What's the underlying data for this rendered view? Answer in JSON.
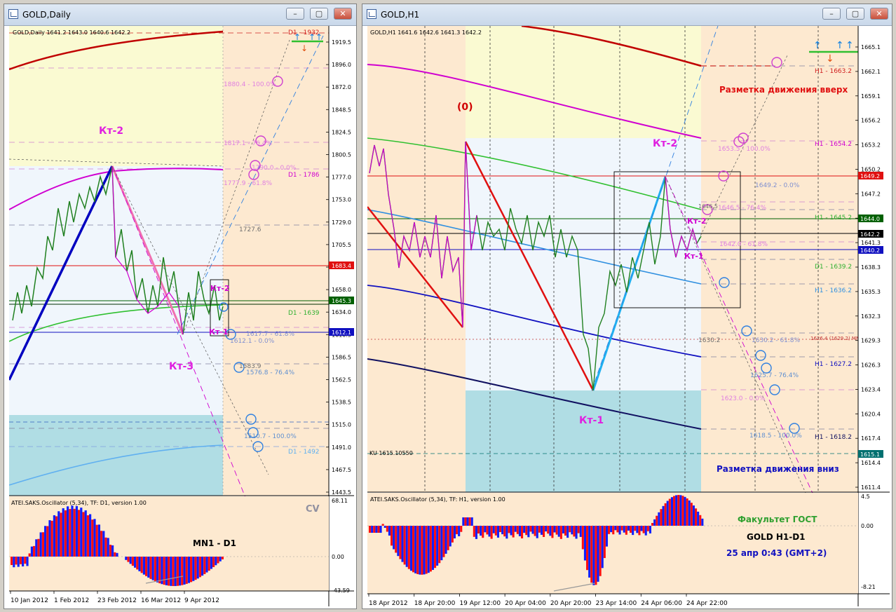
{
  "left_window": {
    "title": "GOLD,Daily",
    "header_text": "GOLD,Daily  1641.2 1643.0 1640.6 1642.2",
    "price_ticks": [
      "1919.5",
      "1896.0",
      "1872.0",
      "1848.5",
      "1824.5",
      "1800.5",
      "1777.0",
      "1753.0",
      "1729.0",
      "1705.5",
      "1682.0",
      "1658.0",
      "1634.0",
      "1610.5",
      "1586.5",
      "1562.5",
      "1538.5",
      "1515.0",
      "1491.0",
      "1467.5",
      "1443.5"
    ],
    "price_boxes": [
      {
        "text": "1683.4",
        "color": "#e01010"
      },
      {
        "text": "1645.3",
        "color": "#006000"
      },
      {
        "text": "1612.1",
        "color": "#1010c0"
      }
    ],
    "labels": {
      "d1_1932": "D1 - 1932",
      "d1_1786": "D1 - 1786",
      "d1_1639": "D1 - 1639",
      "d1_1492": "D1 - 1492",
      "fib_100_top": "1880.4 - 100.0%",
      "fib_764_top": "1817.1 - 76.4%",
      "fib_0_top": "1790.0 - 0.0%",
      "fib_618_top": "1777.9 - 61.8%",
      "lvl_1727": "1727.6",
      "fib_618_low": "1617.7 - 61.8%",
      "fib_0_low": "1612.1 - 0.0%",
      "lvl_1583": "1583.9",
      "fib_764_low": "1576.8 - 76.4%",
      "fib_100_low": "1510.7 - 100.0%",
      "kt2": "Кт-2",
      "kt3": "Кт-3",
      "kt2_small": "Кт-2",
      "kt1_small": "Кт-1"
    },
    "osc": {
      "title": "ATEI.SAKS.Oscillator (5,34), TF: D1, version 1.00",
      "max": "68.11",
      "zero": "0.00",
      "min": "-43.59",
      "cv": "CV",
      "label": "MN1 - D1"
    },
    "dates": [
      "10 Jan 2012",
      "1 Feb 2012",
      "23 Feb 2012",
      "16 Mar 2012",
      "9 Apr 2012"
    ]
  },
  "right_window": {
    "title": "GOLD,H1",
    "header_text": "GOLD,H1  1641.6 1642.6 1641.3 1642.2",
    "price_ticks": [
      "1665.1",
      "1662.1",
      "1659.1",
      "1656.2",
      "1653.2",
      "1650.2",
      "1647.2",
      "1644.2",
      "1641.3",
      "1638.3",
      "1635.3",
      "1632.3",
      "1629.3",
      "1626.3",
      "1623.4",
      "1620.4",
      "1617.4",
      "1614.4",
      "1611.4"
    ],
    "price_boxes": [
      {
        "text": "1649.2",
        "color": "#e01010"
      },
      {
        "text": "1644.0",
        "color": "#006000"
      },
      {
        "text": "1642.2",
        "color": "#000000"
      },
      {
        "text": "1640.2",
        "color": "#1010c0"
      },
      {
        "text": "1615.1",
        "color": "#007070"
      }
    ],
    "labels": {
      "h1_1663": "H1 - 1663.2",
      "h1_1654": "H1 - 1654.2",
      "h1_1645": "H1 - 1645.2",
      "d1_1639": "D1 - 1639.2",
      "h1_1636": "H1 - 1636.2",
      "h1_1627": "H1 - 1627.2",
      "h1_1618": "H1 - 1618.2",
      "up_markup": "Разметка движения вверх",
      "down_markup": "Разметка движения вниз",
      "zero_label": "(0)",
      "kt2": "Кт-2",
      "kt1": "Кт-1",
      "kt2_small": "Кт-2",
      "kt1_small": "Кт-1",
      "fib_100_top": "1653.5 - 100.0%",
      "fib_0_top": "1649.2 - 0.0%",
      "lvl_1646": "1646.5",
      "fib_764_top": "1646.5 - 76.4%",
      "fib_618_top": "1642.0 - 61.8%",
      "lvl_1630": "1630.2",
      "fib_618_low": "1630.2 - 61.8%",
      "mn1_label": "1626.4 (1629.2) MN1",
      "fib_764_low": "1625.7 - 76.4%",
      "fib_0_low": "1623.0 - 0.0%",
      "fib_100_low": "1618.5 - 100.0%",
      "ku": "KU 1615.10550"
    },
    "osc": {
      "title": "ATEI.SAKS.Oscillator (5,34), TF: H1, version 1.00",
      "max": "4.5",
      "zero": "0.00",
      "min": "-8.21"
    },
    "info": {
      "faculty": "Факультет ГОСТ",
      "instrument": "GOLD   H1-D1",
      "time": "25 апр 0:43  (GMT+2)"
    },
    "dates": [
      "18 Apr 2012",
      "18 Apr 20:00",
      "19 Apr 12:00",
      "20 Apr 04:00",
      "20 Apr 20:00",
      "23 Apr 14:00",
      "24 Apr 06:00",
      "24 Apr 22:00"
    ]
  },
  "window_buttons": {
    "minimize": "–",
    "maximize": "▢",
    "close": "✕"
  }
}
